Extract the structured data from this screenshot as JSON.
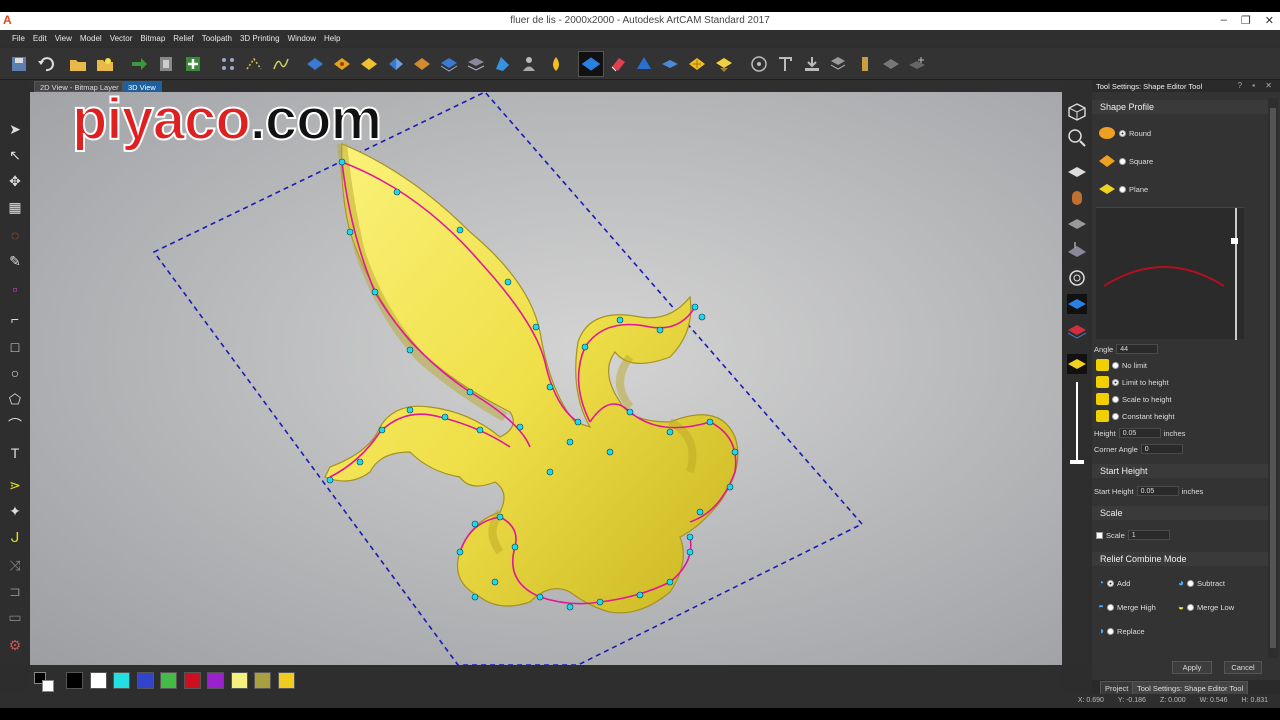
{
  "window": {
    "logo_glyph": "A",
    "title": "fluer de lis - 2000x2000 - Autodesk ArtCAM Standard 2017",
    "min": "–",
    "max": "❐",
    "close": "✕"
  },
  "menu": [
    "File",
    "Edit",
    "View",
    "Model",
    "Vector",
    "Bitmap",
    "Relief",
    "Toolpath",
    "3D Printing",
    "Window",
    "Help"
  ],
  "view_tabs": {
    "tab1": "2D View - Bitmap Layer",
    "tab2": "3D View"
  },
  "watermark": {
    "part1": "piyaco",
    "part2": ".com"
  },
  "panel": {
    "title": "Tool Settings: Shape Editor Tool",
    "header_btns": "? ▪ ✕",
    "shape_profile": {
      "heading": "Shape Profile",
      "options": [
        "Round",
        "Square",
        "Plane"
      ],
      "selected": "Round"
    },
    "angle": {
      "label": "Angle",
      "value": "44"
    },
    "limits": {
      "options": [
        "No limit",
        "Limit to height",
        "Scale to height",
        "Constant height"
      ],
      "selected": "Limit to height"
    },
    "height": {
      "label": "Height",
      "value": "0.05",
      "unit": "inches"
    },
    "corner_angle": {
      "label": "Corner Angle",
      "value": "0"
    },
    "start_height": {
      "heading": "Start Height",
      "label": "Start Height",
      "value": "0.05",
      "unit": "inches"
    },
    "scale": {
      "heading": "Scale",
      "label": "Scale",
      "value": "1"
    },
    "combine": {
      "heading": "Relief Combine Mode",
      "options": [
        "Add",
        "Subtract",
        "Merge High",
        "Merge Low",
        "Replace"
      ],
      "selected": "Add"
    },
    "apply": "Apply",
    "cancel": "Cancel"
  },
  "bottom_tabs": {
    "project": "Project",
    "tool": "Tool Settings: Shape Editor Tool"
  },
  "palette": [
    "#000000",
    "#ffffff",
    "#22e0e0",
    "#3344cc",
    "#44bb44",
    "#cc1020",
    "#9922cc",
    "#f6f080",
    "#a8a040",
    "#f0cc20"
  ],
  "status": {
    "x": "X: 0.690",
    "y": "Y: -0.186",
    "z": "Z: 0.000",
    "w": "W: 0.546",
    "h": "H: 0.831"
  },
  "colors": {
    "relief_yellow": "#f2e44a",
    "vector_magenta": "#e0189a",
    "node_cyan": "#20d8e8",
    "bbox_blue": "#1a1ab8",
    "active_tab": "#1e5fa0"
  }
}
